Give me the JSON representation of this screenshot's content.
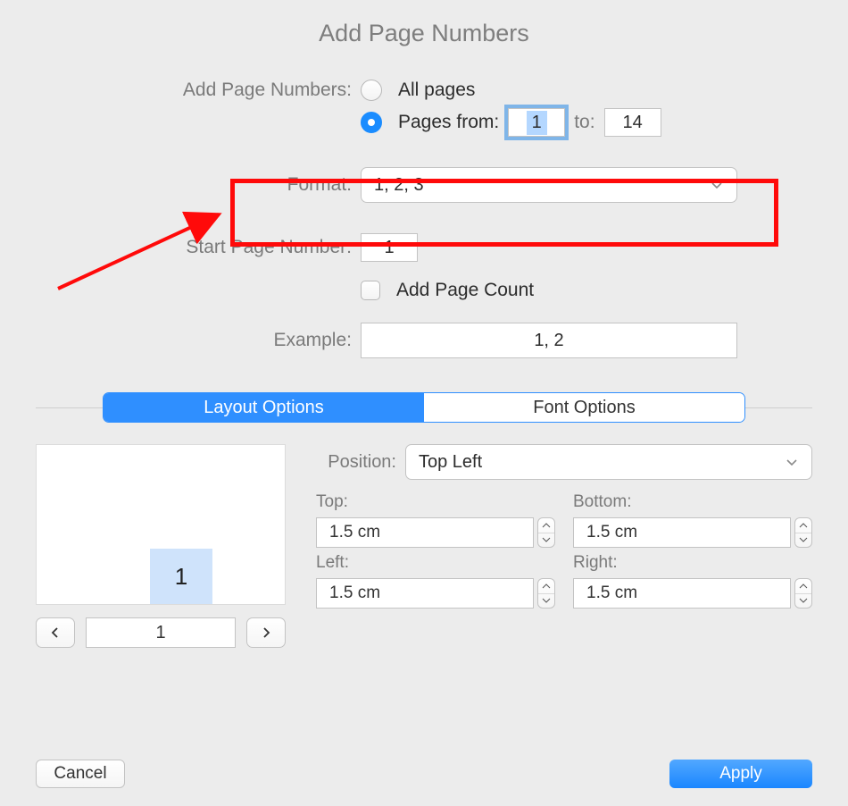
{
  "title": "Add Page Numbers",
  "addPageNumbers": {
    "label": "Add Page Numbers:",
    "allPagesLabel": "All pages",
    "pagesFromLabel": "Pages from:",
    "fromValue": "1",
    "toLabel": "to:",
    "toValue": "14",
    "selected": "range"
  },
  "format": {
    "label": "Format:",
    "value": "1, 2, 3"
  },
  "startPage": {
    "label": "Start Page Number:",
    "value": "1"
  },
  "addPageCount": {
    "label": "Add Page Count",
    "checked": false
  },
  "example": {
    "label": "Example:",
    "value": "1, 2"
  },
  "tabs": {
    "layout": "Layout Options",
    "font": "Font Options",
    "active": "layout"
  },
  "position": {
    "label": "Position:",
    "value": "Top Left"
  },
  "margins": {
    "topLabel": "Top:",
    "topValue": "1.5 cm",
    "bottomLabel": "Bottom:",
    "bottomValue": "1.5 cm",
    "leftLabel": "Left:",
    "leftValue": "1.5 cm",
    "rightLabel": "Right:",
    "rightValue": "1.5 cm"
  },
  "preview": {
    "pageDigit": "1",
    "pagerValue": "1"
  },
  "footer": {
    "cancel": "Cancel",
    "apply": "Apply"
  }
}
